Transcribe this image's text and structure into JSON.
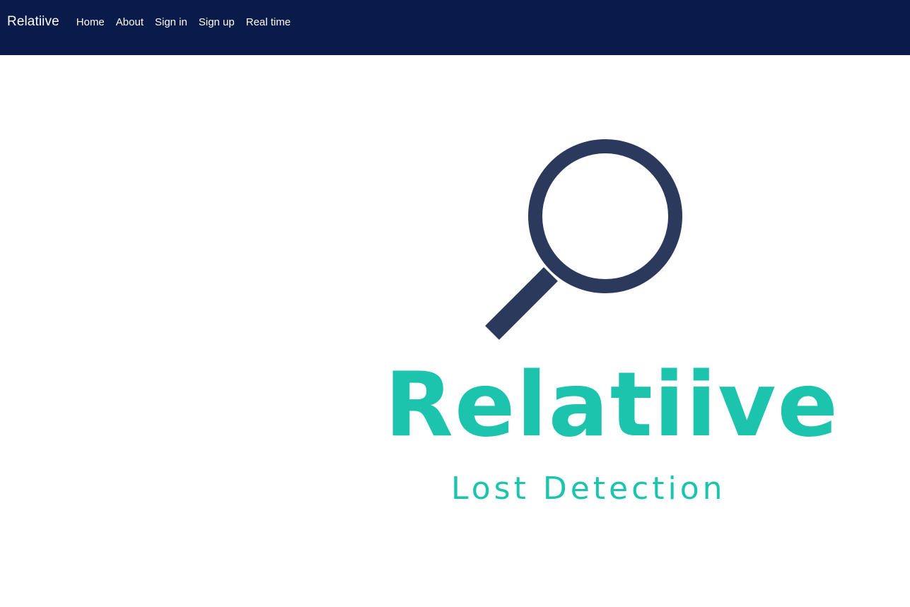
{
  "navbar": {
    "brand": "Relatiive",
    "links": [
      {
        "label": "Home"
      },
      {
        "label": "About"
      },
      {
        "label": "Sign in"
      },
      {
        "label": "Sign up"
      },
      {
        "label": "Real time"
      }
    ]
  },
  "logo": {
    "icon": "magnifier-icon",
    "word": "Relatiive",
    "tagline": "Lost Detection"
  },
  "colors": {
    "navbar_bg": "#0a1a4a",
    "navbar_text": "#ffffff",
    "logo_teal": "#1cc3ad",
    "logo_navy": "#2b3a5c",
    "page_bg": "#ffffff"
  }
}
